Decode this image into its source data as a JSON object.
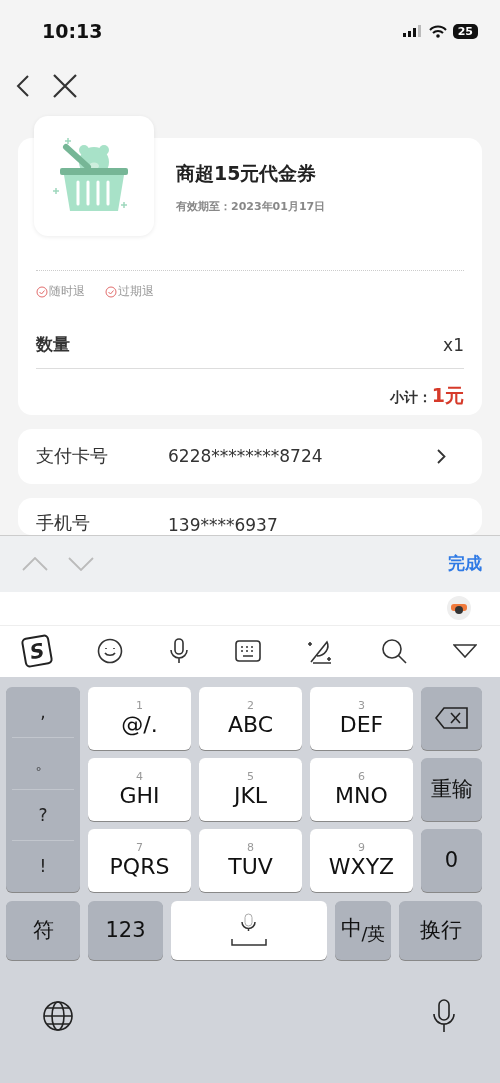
{
  "status_bar": {
    "time": "10:13",
    "battery": "25"
  },
  "product": {
    "title": "商超15元代金券",
    "validity": "有效期至：2023年01月17日",
    "tags": [
      {
        "label": "随时退"
      },
      {
        "label": "过期退"
      }
    ],
    "quantity_label": "数量",
    "quantity": "x1",
    "subtotal_label": "小计：",
    "subtotal": "1元"
  },
  "rows": [
    {
      "label": "支付卡号",
      "value": "6228********8724",
      "has_arrow": true
    },
    {
      "label": "手机号",
      "value": "139****6937",
      "has_arrow": false
    }
  ],
  "accessory_bar": {
    "done": "完成"
  },
  "ime_toolbar": {
    "logo": "S"
  },
  "keyboard": {
    "punctuation": [
      ",",
      "。",
      "?",
      "!"
    ],
    "keys": [
      {
        "digit": "1",
        "letters": "@/."
      },
      {
        "digit": "2",
        "letters": "ABC"
      },
      {
        "digit": "3",
        "letters": "DEF"
      },
      {
        "digit": "4",
        "letters": "GHI"
      },
      {
        "digit": "5",
        "letters": "JKL"
      },
      {
        "digit": "6",
        "letters": "MNO"
      },
      {
        "digit": "7",
        "letters": "PQRS"
      },
      {
        "digit": "8",
        "letters": "TUV"
      },
      {
        "digit": "9",
        "letters": "WXYZ"
      }
    ],
    "side_keys": [
      {
        "kind": "backspace"
      },
      {
        "kind": "text",
        "label": "重输"
      },
      {
        "kind": "text",
        "label": "0"
      }
    ],
    "bottom_row": [
      {
        "kind": "text",
        "label": "符"
      },
      {
        "kind": "text",
        "label": "123"
      },
      {
        "kind": "space"
      },
      {
        "kind": "text",
        "label": "中$_{/英}$"
      },
      {
        "kind": "text",
        "label": "换行"
      }
    ]
  }
}
